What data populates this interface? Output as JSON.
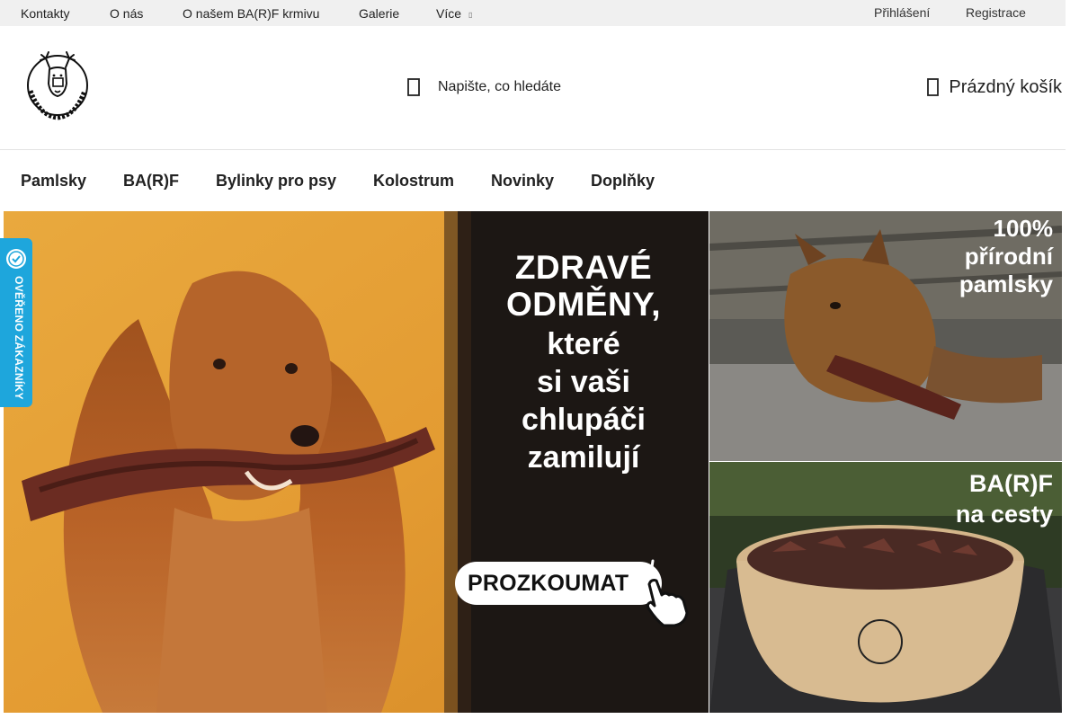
{
  "topbar": {
    "links": [
      "Kontakty",
      "O nás",
      "O našem BA(R)F krmivu",
      "Galerie",
      "Více"
    ],
    "login": "Přihlášení",
    "register": "Registrace"
  },
  "header": {
    "logo_alt": "Marley & Harry's",
    "search_placeholder": "Napište, co hledáte",
    "cart_label": "Prázdný košík"
  },
  "nav": {
    "items": [
      "Pamlsky",
      "BA(R)F",
      "Bylinky pro psy",
      "Kolostrum",
      "Novinky",
      "Doplňky"
    ]
  },
  "banners": {
    "main": {
      "headline_line1": "ZDRAVÉ",
      "headline_line2": "ODMĚNY,",
      "headline_line3": "které",
      "headline_line4": "si vaši",
      "headline_line5": "chlupáči",
      "headline_line6": "zamilují",
      "cta": "PROZKOUMAT"
    },
    "right_top": {
      "line1": "100%",
      "line2": "přírodní",
      "line3": "pamlsky"
    },
    "right_bottom": {
      "line1": "BA(R)F",
      "line2": "na cesty"
    }
  },
  "verified_badge": {
    "label": "OVĚŘENO ZÁKAZNÍKY"
  },
  "colors": {
    "topbar_bg": "#f0f0f0",
    "badge_blue": "#1ea6dc",
    "banner_orange": "#e7a53b"
  }
}
